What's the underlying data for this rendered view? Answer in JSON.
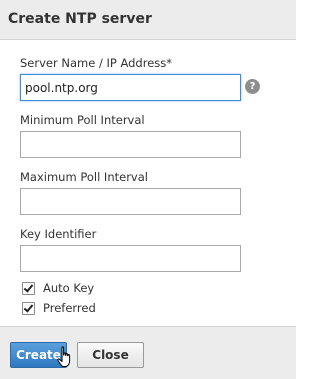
{
  "dialog": {
    "title": "Create NTP server"
  },
  "form": {
    "server_name": {
      "label": "Server Name / IP Address*",
      "value": "pool.ntp.org"
    },
    "help_icon": {
      "glyph": "?"
    },
    "min_poll": {
      "label": "Minimum Poll Interval",
      "value": ""
    },
    "max_poll": {
      "label": "Maximum Poll Interval",
      "value": ""
    },
    "key_identifier": {
      "label": "Key Identifier",
      "value": ""
    },
    "auto_key": {
      "label": "Auto Key",
      "checked": true
    },
    "preferred": {
      "label": "Preferred",
      "checked": true
    }
  },
  "footer": {
    "create_label": "Create",
    "close_label": "Close"
  },
  "colors": {
    "primary_button": "#3a84cc",
    "header_background": "#ececec",
    "focus_border": "#3d8ed6"
  },
  "icons": {
    "help": "question-circle-icon",
    "cursor": "hand-pointer-icon",
    "checkmark": "check-icon"
  }
}
